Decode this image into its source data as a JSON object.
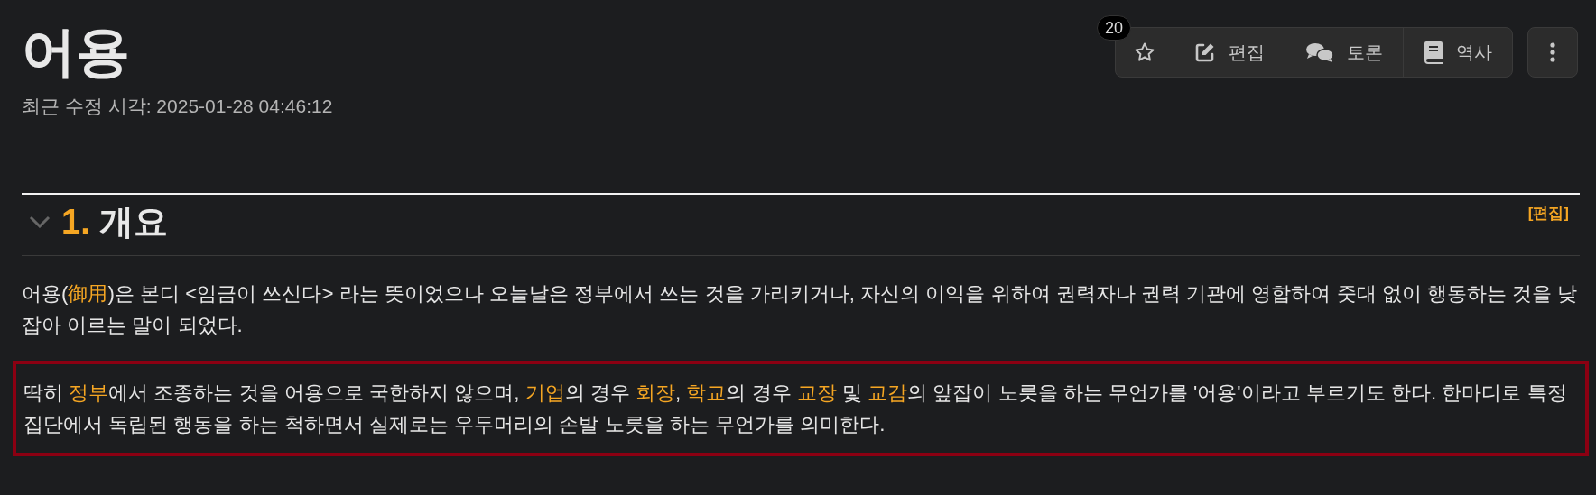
{
  "title": "어용",
  "last_modified": "최근 수정 시각: 2025-01-28 04:46:12",
  "star_count": "20",
  "toolbar": [
    {
      "kind": "star"
    },
    {
      "kind": "edit",
      "label": "편집"
    },
    {
      "kind": "discuss",
      "label": "토론"
    },
    {
      "kind": "history",
      "label": "역사"
    }
  ],
  "section": {
    "number": "1.",
    "title": "개요",
    "expanded": true,
    "edit_link": "[편집]"
  },
  "paragraphs": [
    {
      "kind": "plain",
      "segments": [
        {
          "kind": "text",
          "text": "어용("
        },
        {
          "kind": "link",
          "text": "御用"
        },
        {
          "kind": "text",
          "text": ")은 본디 <임금이 쓰신다> 라는 뜻이었으나 오늘날은 정부에서 쓰는 것을 가리키거나, 자신의 이익을 위하여 권력자나 권력 기관에 영합하여 줏대 없이 행동하는 것을 낮잡아 이르는 말이 되었다."
        }
      ]
    },
    {
      "kind": "boxed",
      "segments": [
        {
          "kind": "text",
          "text": "딱히 "
        },
        {
          "kind": "link",
          "text": "정부"
        },
        {
          "kind": "text",
          "text": "에서 조종하는 것을 어용으로 국한하지 않으며, "
        },
        {
          "kind": "link",
          "text": "기업"
        },
        {
          "kind": "text",
          "text": "의 경우 "
        },
        {
          "kind": "link",
          "text": "회장"
        },
        {
          "kind": "text",
          "text": ", "
        },
        {
          "kind": "link",
          "text": "학교"
        },
        {
          "kind": "text",
          "text": "의 경우 "
        },
        {
          "kind": "link",
          "text": "교장"
        },
        {
          "kind": "text",
          "text": " 및 "
        },
        {
          "kind": "link",
          "text": "교감"
        },
        {
          "kind": "text",
          "text": "의 앞잡이 노릇을 하는 무언가를 '어용'이라고 부르기도 한다. 한마디로 특정 집단에서 독립된 행동을 하는 척하면서 실제로는 우두머리의 손발 노릇을 하는 무언가를 의미한다."
        }
      ]
    }
  ]
}
